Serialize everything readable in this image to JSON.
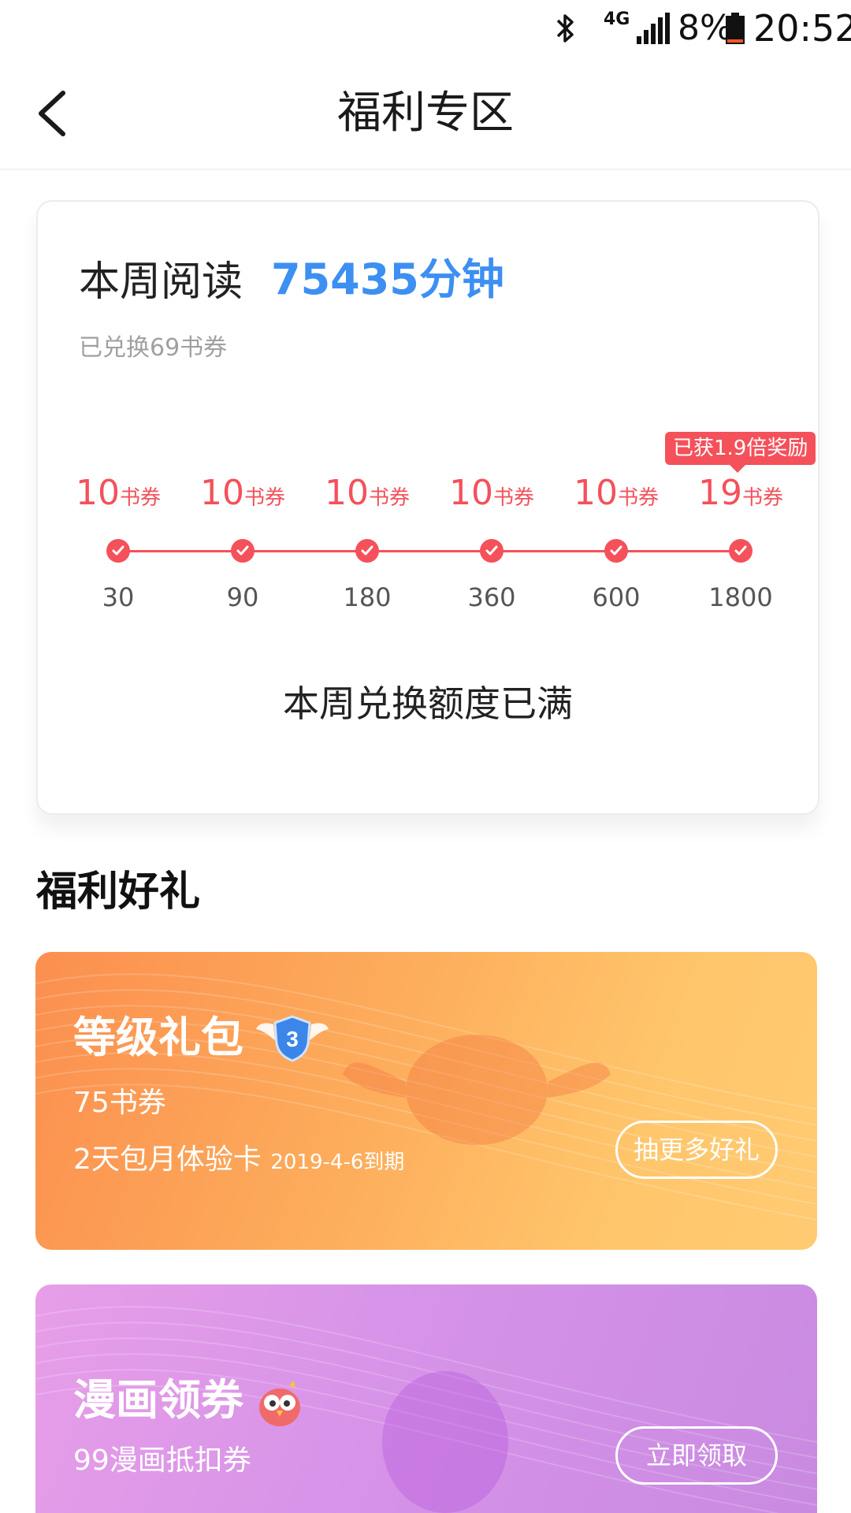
{
  "status_bar": {
    "network": "4G",
    "battery_percent": "8%",
    "time": "20:52",
    "icons": [
      "bluetooth-icon",
      "signal-icon",
      "battery-icon"
    ]
  },
  "header": {
    "title": "福利专区",
    "back_icon": "chevron-left-icon"
  },
  "reading": {
    "label": "本周阅读",
    "value": "75435分钟",
    "exchanged": "已兑换69书券",
    "bonus_tag": "已获1.9倍奖励",
    "milestones": [
      {
        "reward": "10",
        "unit": "书券",
        "minutes": "30",
        "achieved": true
      },
      {
        "reward": "10",
        "unit": "书券",
        "minutes": "90",
        "achieved": true
      },
      {
        "reward": "10",
        "unit": "书券",
        "minutes": "180",
        "achieved": true
      },
      {
        "reward": "10",
        "unit": "书券",
        "minutes": "360",
        "achieved": true
      },
      {
        "reward": "10",
        "unit": "书券",
        "minutes": "600",
        "achieved": true
      },
      {
        "reward": "19",
        "unit": "书券",
        "minutes": "1800",
        "achieved": true
      }
    ],
    "status": "本周兑换额度已满",
    "accent_color": "#3d8ff2",
    "reward_color": "#f4515b"
  },
  "gifts": {
    "section_title": "福利好礼",
    "level_pack": {
      "title": "等级礼包",
      "badge_icon": "level-3-badge-icon",
      "badge_level": "3",
      "line1": "75书券",
      "line2": "2天包月体验卡",
      "line2_note": "2019-4-6到期",
      "button": "抽更多好礼"
    },
    "comic_coupon": {
      "title": "漫画领券",
      "icon": "owl-mascot-icon",
      "line1": "99漫画抵扣券",
      "button": "立即领取"
    }
  }
}
